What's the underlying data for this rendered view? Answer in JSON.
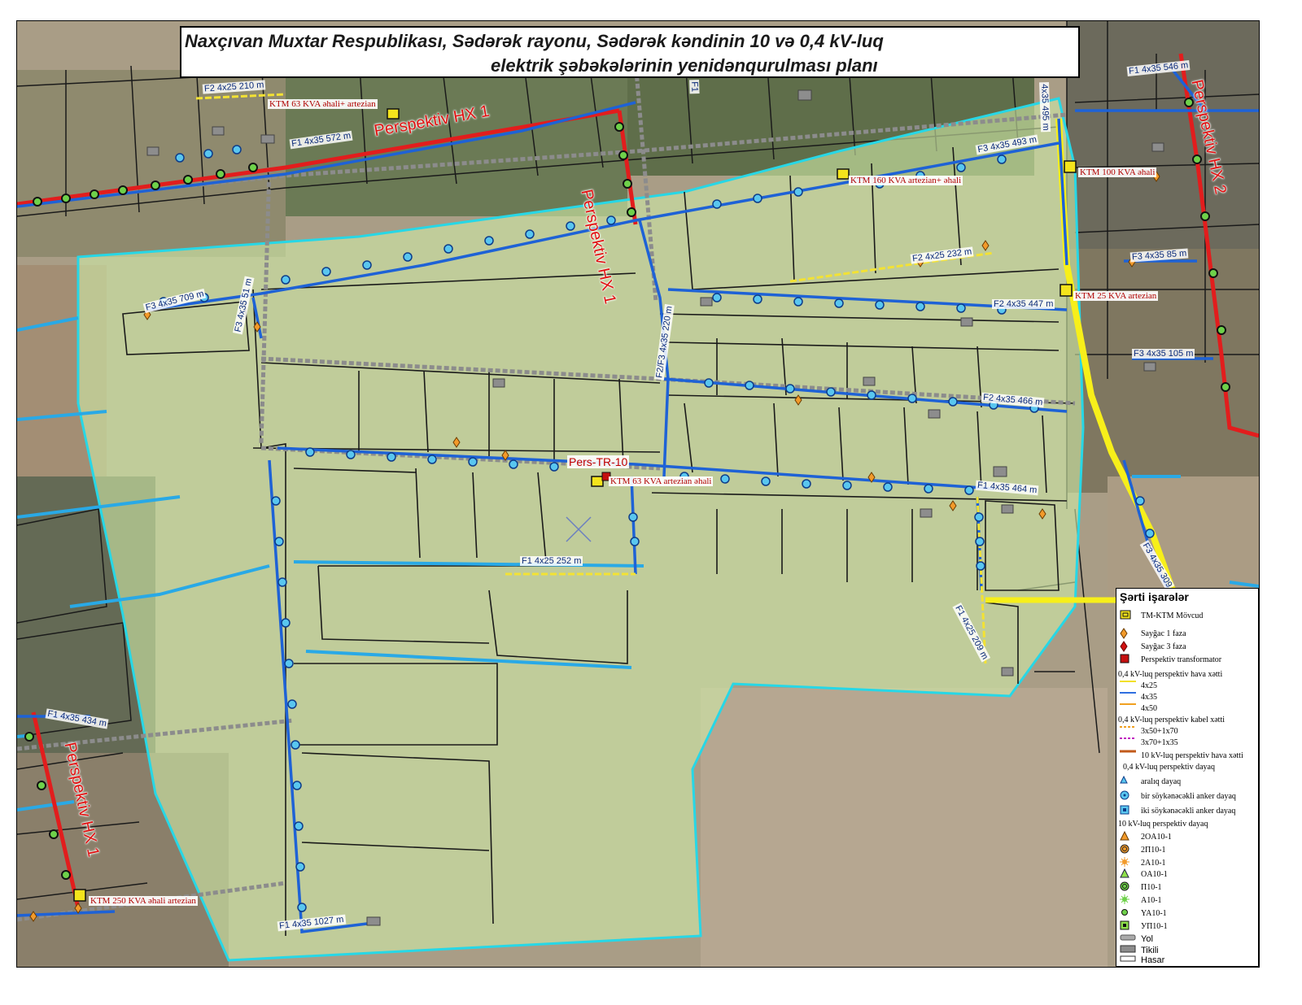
{
  "title": {
    "line1": "Naxçıvan Muxtar Respublikası,  Sədərək rayonu, Sədərək kəndinin 10 və 0,4 kV-luq",
    "line2": "elektrik şəbəkələrinin yenidənqurulması planı"
  },
  "map": {
    "hx_labels": [
      "Perspektiv HX 1",
      "Perspektiv HX 1",
      "Perspektiv HX 2",
      "Perspektiv HX 1"
    ],
    "transformers": [
      "KTM 63 KVA əhali+ artezian",
      "KTM 160 KVA artezian+ əhali",
      "KTM 100 KVA əhali",
      "KTM 25 KVA artezian",
      "KTM 63 KVA artezian əhali",
      "KTM 250 KVA əhali artezian"
    ],
    "perspective_transformer": "Pers-TR-10",
    "line_labels": [
      "F2 4x25 210 m",
      "F1 4x35 572 m",
      "F1 4x35 546 m",
      "F3 4x35 493 m",
      "4x35 495 m",
      "F2 4x25 232 m",
      "F3 4x35 709 m",
      "F3 4x35 51 m",
      "F2/F3 4x35 220 m",
      "F2 4x35 447 m",
      "F3 4x35 85 m",
      "F3 4x35 105 m",
      "F2 4x35 466 m",
      "F1 4x35 464 m",
      "F1 4x25 252 m",
      "F3 4x35 309",
      "F1 4x25 209 m",
      "F1 4x35 434 m",
      "F1 4x35 1027 m",
      "F1"
    ]
  },
  "legend": {
    "title": "Şərti işarələr",
    "items": [
      {
        "label": "TM-KTM Mövcud",
        "icon": "existing-transformer-icon"
      },
      {
        "label": "Sayğac 1 faza",
        "icon": "meter-1-phase-icon"
      },
      {
        "label": "Sayğac 3 faza",
        "icon": "meter-3-phase-icon"
      },
      {
        "label": "Perspektiv transformator",
        "icon": "perspective-transformer-icon"
      }
    ],
    "overhead_heading": "0,4 kV-luq perspektiv hava xətti",
    "overhead": [
      {
        "label": "4x25",
        "color": "#f2e02a"
      },
      {
        "label": "4x35",
        "color": "#2f6fe0"
      },
      {
        "label": "4x50",
        "color": "#f0a020"
      }
    ],
    "cable_heading": "0,4 kV-luq perspektiv kabel xətti",
    "cable": [
      {
        "label": "3x50+1x70",
        "color": "#f0a020"
      },
      {
        "label": "3x70+1x35",
        "color": "#c020c0"
      }
    ],
    "hv_line_label": "10 kV-luq perspektiv hava xətti",
    "hv_line_color": "#c25a1a",
    "pole04_heading": "0,4 kV-luq perspektiv  dayaq",
    "poles04": [
      {
        "label": "aralıq dayaq",
        "icon": "intermediate-pole-icon"
      },
      {
        "label": "bir söykənəcəkli anker dayaq",
        "icon": "single-anchor-pole-icon"
      },
      {
        "label": "iki söykənəcəkli anker dayaq",
        "icon": "double-anchor-pole-icon"
      }
    ],
    "pole10_heading": "10 kV-luq perspektiv dayaq",
    "poles10": [
      "2OA10-1",
      "2П10-1",
      "2A10-1",
      "OA10-1",
      "П10-1",
      "A10-1",
      "YA10-1",
      "УП10-1"
    ],
    "misc": [
      "Yol",
      "Tikili",
      "Hasar"
    ]
  }
}
